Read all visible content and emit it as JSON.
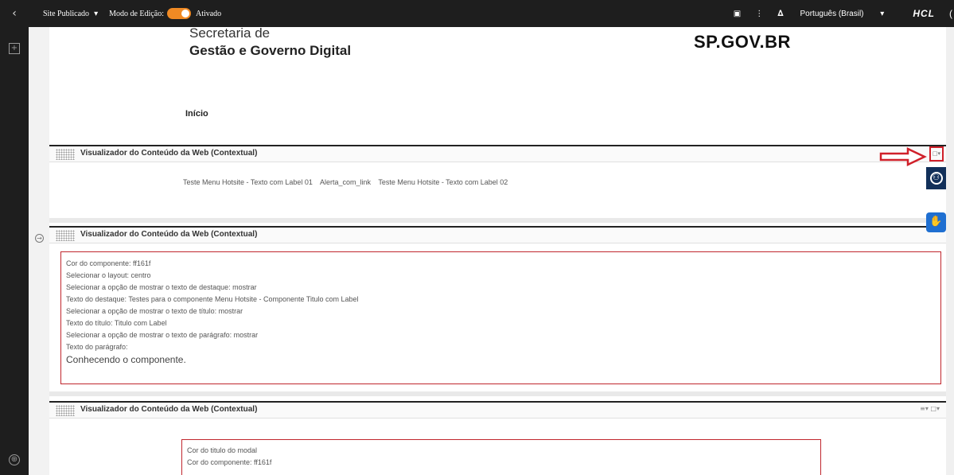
{
  "topbar": {
    "back_icon": "chevron-left-icon",
    "site_label": "Site Publicado",
    "site_chevron": "▾",
    "edit_mode_label": "Modo de Edição:",
    "edit_mode_state": "Ativado",
    "toggle_color": "#f08a24",
    "language": "Português (Brasil)",
    "language_chevron": "▾",
    "brand": "HCL"
  },
  "header": {
    "org_line1": "Secretaria de",
    "org_line2": "Gestão e Governo Digital",
    "logo_text": ".GOV.BR",
    "logo_prefix": "SP",
    "breadcrumb": "Início"
  },
  "portlets": [
    {
      "title": "Visualizador do Conteúdo da Web (Contextual)",
      "links": [
        "Teste Menu Hotsite - Texto com Label 01",
        "Alerta_com_link",
        "Teste Menu Hotsite - Texto com Label 02"
      ]
    },
    {
      "title": "Visualizador do Conteúdo da Web (Contextual)",
      "lines": [
        "Cor do componente: ff161f",
        "Selecionar o layout: centro",
        "Selecionar a opção de mostrar o texto de destaque: mostrar",
        "Texto do destaque: Testes para o componente Menu Hotsite - Componente Titulo com Label",
        "Selecionar a opção de mostrar o texto de título: mostrar",
        "Texto do título: Titulo com Label",
        "Selecionar a opção de mostrar o texto de parágrafo: mostrar",
        "Texto do parágrafo:"
      ],
      "paragraph": "Conhecendo o componente."
    },
    {
      "title": "Visualizador do Conteúdo da Web (Contextual)",
      "lines": [
        "Cor do titulo do modal",
        "Cor do componente: ff161f"
      ]
    }
  ],
  "colors": {
    "accent_red": "#c0262d",
    "accessibility_blue": "#12305a",
    "vlibras_blue": "#1f6fd1"
  }
}
